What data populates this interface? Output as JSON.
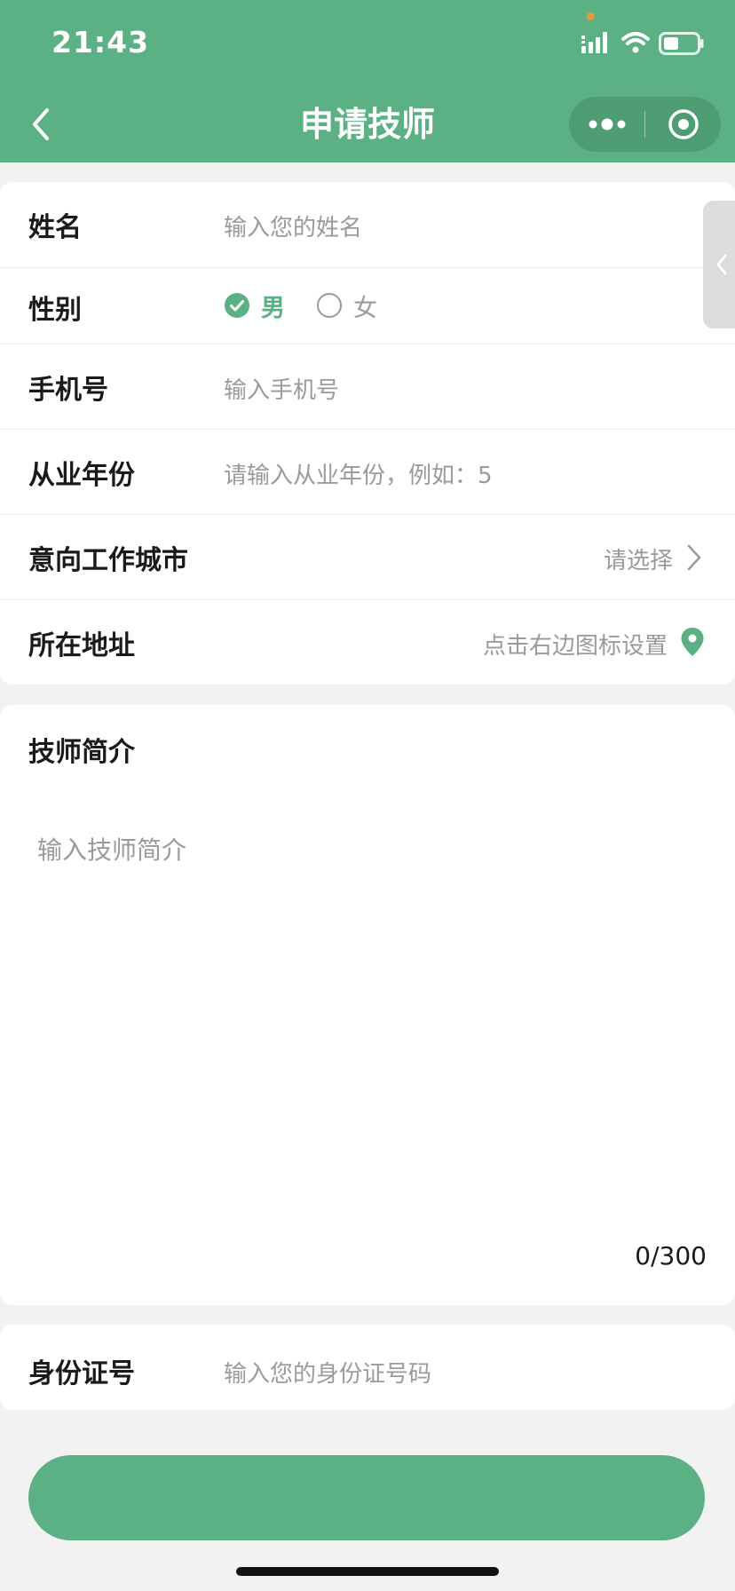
{
  "status_bar": {
    "time": "21:43"
  },
  "nav": {
    "title": "申请技师"
  },
  "form": {
    "name": {
      "label": "姓名",
      "placeholder": "输入您的姓名"
    },
    "gender": {
      "label": "性别",
      "options": [
        "男",
        "女"
      ],
      "selected": "男"
    },
    "phone": {
      "label": "手机号",
      "placeholder": "输入手机号"
    },
    "years": {
      "label": "从业年份",
      "placeholder": "请输入从业年份，例如：5"
    },
    "city": {
      "label": "意向工作城市",
      "value": "请选择"
    },
    "address": {
      "label": "所在地址",
      "value": "点击右边图标设置"
    }
  },
  "intro": {
    "label": "技师简介",
    "placeholder": "输入技师简介",
    "counter": "0/300"
  },
  "id_card": {
    "label": "身份证号",
    "placeholder": "输入您的身份证号码"
  },
  "icons": {
    "back": "chevron-left-icon",
    "more": "more-dots-icon",
    "close": "target-close-icon",
    "check": "check-circle-icon",
    "radio": "radio-empty-icon",
    "arrow": "chevron-right-icon",
    "location": "location-pin-icon"
  },
  "colors": {
    "brand_green": "#5bb184",
    "capsule_green": "#4d9c72",
    "placeholder_gray": "#9a9a9a"
  }
}
